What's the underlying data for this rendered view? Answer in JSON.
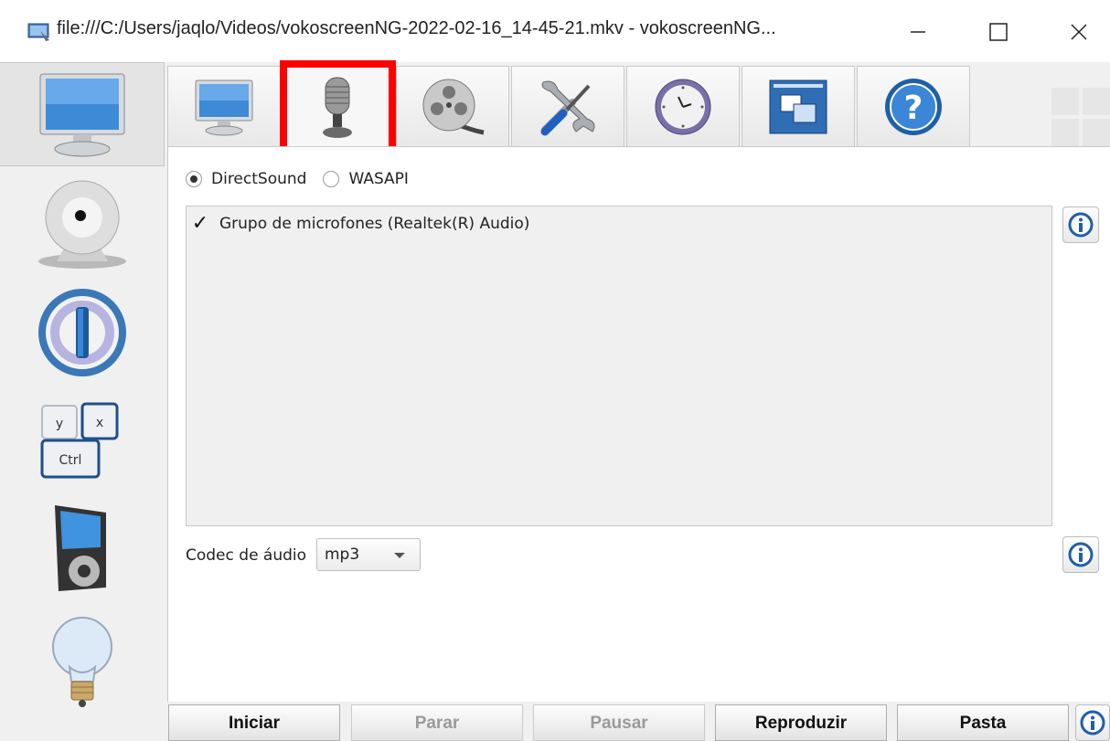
{
  "window": {
    "title": "file:///C:/Users/jaqlo/Videos/vokoscreenNG-2022-02-16_14-45-21.mkv - vokoscreenNG...",
    "minimize_icon": "minimize-icon",
    "maximize_icon": "maximize-icon",
    "close_icon": "close-icon"
  },
  "sidebar": {
    "items": [
      {
        "icon": "monitor-icon",
        "active": true
      },
      {
        "icon": "webcam-icon"
      },
      {
        "icon": "power-ring-icon"
      },
      {
        "icon": "keyboard-shortcuts-icon",
        "keys": [
          "y",
          "x",
          "Ctrl"
        ]
      },
      {
        "icon": "media-player-icon"
      },
      {
        "icon": "lightbulb-icon"
      }
    ]
  },
  "tabs": [
    {
      "icon": "screen-icon"
    },
    {
      "icon": "microphone-icon",
      "selected": true,
      "highlighted": true
    },
    {
      "icon": "film-reel-icon"
    },
    {
      "icon": "tools-icon"
    },
    {
      "icon": "clock-icon"
    },
    {
      "icon": "windows-icon"
    },
    {
      "icon": "help-icon"
    }
  ],
  "audio": {
    "backend_options": [
      {
        "label": "DirectSound",
        "selected": true
      },
      {
        "label": "WASAPI",
        "selected": false
      }
    ],
    "devices": [
      {
        "label": "Grupo de microfones (Realtek(R) Audio)",
        "checked": true
      }
    ],
    "codec_label": "Codec de áudio",
    "codec_value": "mp3"
  },
  "buttons": {
    "start": "Iniciar",
    "stop": "Parar",
    "pause": "Pausar",
    "play": "Reproduzir",
    "folder": "Pasta"
  },
  "colors": {
    "highlight": "#ff0000",
    "accent": "#2f6db5"
  }
}
